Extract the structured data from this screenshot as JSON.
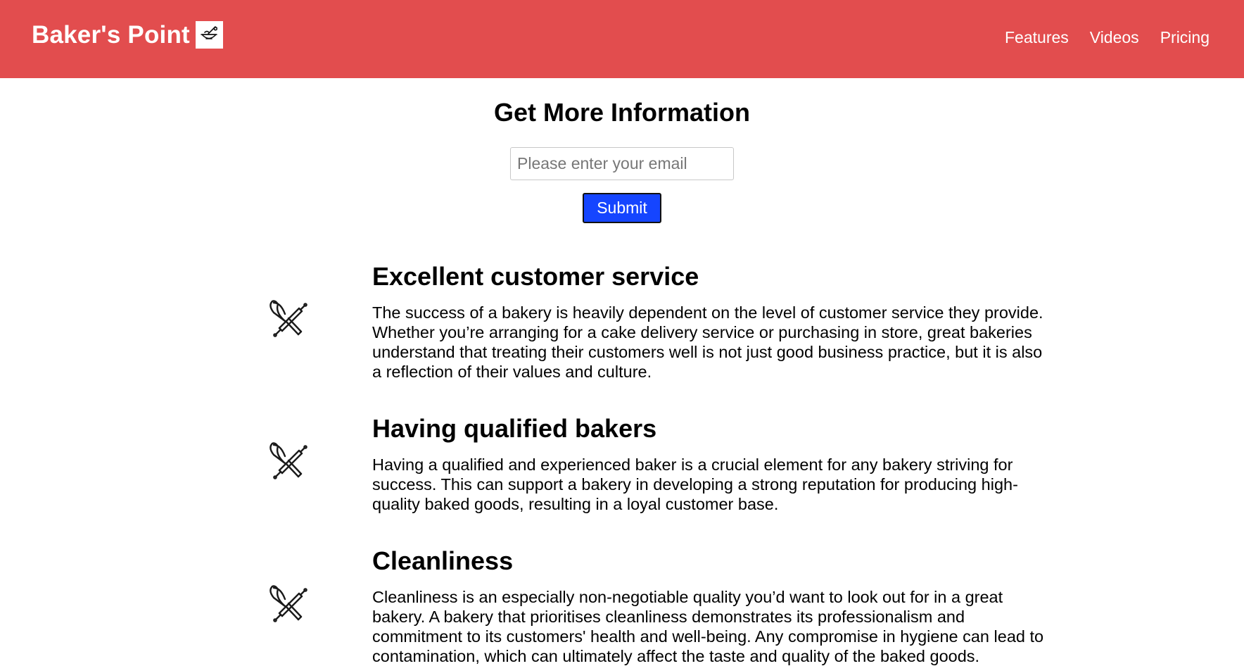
{
  "header": {
    "brand": "Baker's Point",
    "logo_icon": "mixing-bowl-whisk-icon",
    "background": "#e24d4e",
    "nav": [
      {
        "label": "Features"
      },
      {
        "label": "Videos"
      },
      {
        "label": "Pricing"
      }
    ]
  },
  "form": {
    "title": "Get More Information",
    "email_placeholder": "Please enter your email",
    "email_value": "",
    "submit_label": "Submit",
    "submit_color": "#1545ff"
  },
  "features": [
    {
      "icon": "whisk-rolling-pin-icon",
      "title": "Excellent customer service",
      "description": "The success of a bakery is heavily dependent on the level of customer service they provide. Whether you’re arranging for a cake delivery service or purchasing in store, great bakeries understand that treating their customers well is not just good business practice, but it is also a reflection of their values and culture."
    },
    {
      "icon": "whisk-rolling-pin-icon",
      "title": "Having qualified bakers",
      "description": "Having a qualified and experienced baker is a crucial element for any bakery striving for success. This can support a bakery in developing a strong reputation for producing high-quality baked goods, resulting in a loyal customer base."
    },
    {
      "icon": "whisk-rolling-pin-icon",
      "title": "Cleanliness",
      "description": "Cleanliness is an especially non-negotiable quality you’d want to look out for in a great bakery. A bakery that prioritises cleanliness demonstrates its professionalism and commitment to its customers' health and well-being. Any compromise in hygiene can lead to contamination, which can ultimately affect the taste and quality of the baked goods."
    }
  ]
}
